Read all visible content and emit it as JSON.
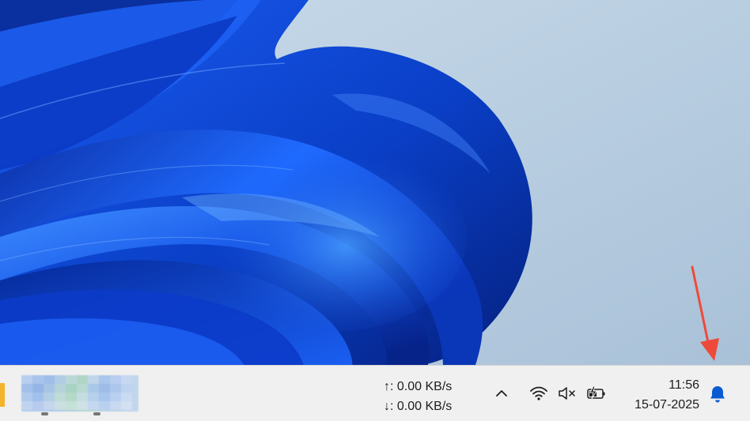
{
  "taskbar": {
    "network_speed": {
      "upload": "↑: 0.00 KB/s",
      "download": "↓: 0.00 KB/s"
    },
    "tray_icons": [
      "chevron-up-icon",
      "wifi-icon",
      "speaker-muted-icon",
      "battery-charging-icon"
    ],
    "clock": {
      "time": "11:56",
      "date": "15-07-2025"
    },
    "notification_icon": "bell-icon"
  },
  "colors": {
    "accent": "#0a5bd3",
    "annotation_arrow": "#ee4a3a",
    "taskbar_bg": "#f0f0f0"
  }
}
